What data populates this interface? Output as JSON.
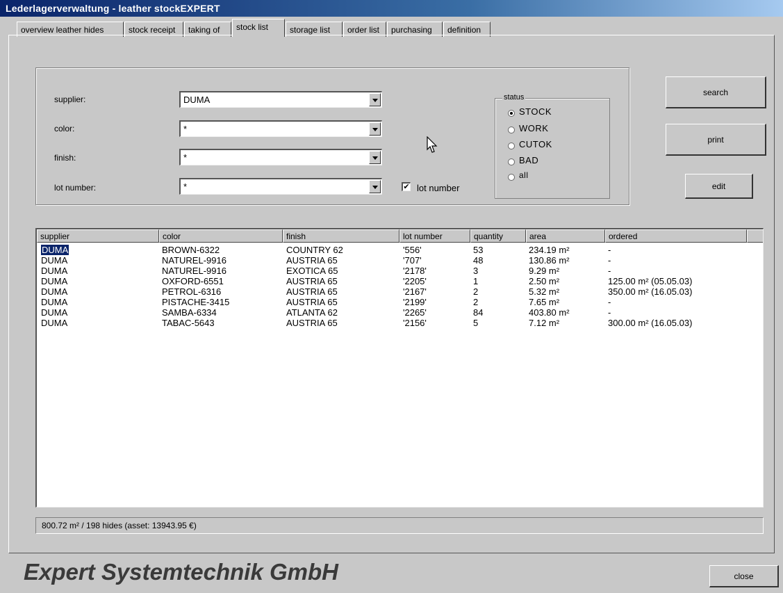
{
  "window": {
    "title": "Lederlagerverwaltung - leather stockEXPERT"
  },
  "tabs": [
    {
      "label": "overview leather hides"
    },
    {
      "label": "stock receipt"
    },
    {
      "label": "taking of"
    },
    {
      "label": "stock list"
    },
    {
      "label": "storage list"
    },
    {
      "label": "order list"
    },
    {
      "label": "purchasing"
    },
    {
      "label": "definition"
    }
  ],
  "filters": {
    "supplier_label": "supplier:",
    "supplier_value": "DUMA",
    "color_label": "color:",
    "color_value": "*",
    "finish_label": "finish:",
    "finish_value": "*",
    "lot_label": "lot number:",
    "lot_value": "*",
    "lot_checkbox_label": "lot number",
    "lot_checkbox_checked": "✔"
  },
  "status": {
    "legend": "status",
    "options": [
      "STOCK",
      "WORK",
      "CUTOK",
      "BAD",
      "all"
    ],
    "selected": "STOCK"
  },
  "buttons": {
    "search": "search",
    "print": "print",
    "edit": "edit",
    "close": "close"
  },
  "table": {
    "columns": [
      "supplier",
      "color",
      "finish",
      "lot number",
      "quantity",
      "area",
      "ordered"
    ],
    "rows": [
      {
        "supplier": "DUMA",
        "color": "BROWN-6322",
        "finish": "COUNTRY 62",
        "lot": "'556'",
        "quantity": "53",
        "area": "234.19 m²",
        "ordered": "-"
      },
      {
        "supplier": "DUMA",
        "color": "NATUREL-9916",
        "finish": "AUSTRIA 65",
        "lot": "'707'",
        "quantity": "48",
        "area": "130.86 m²",
        "ordered": "-"
      },
      {
        "supplier": "DUMA",
        "color": "NATUREL-9916",
        "finish": "EXOTICA 65",
        "lot": "'2178'",
        "quantity": "3",
        "area": "9.29 m²",
        "ordered": "-"
      },
      {
        "supplier": "DUMA",
        "color": "OXFORD-6551",
        "finish": "AUSTRIA 65",
        "lot": "'2205'",
        "quantity": "1",
        "area": "2.50 m²",
        "ordered": "125.00 m² (05.05.03)"
      },
      {
        "supplier": "DUMA",
        "color": "PETROL-6316",
        "finish": "AUSTRIA 65",
        "lot": "'2167'",
        "quantity": "2",
        "area": "5.32 m²",
        "ordered": "350.00 m² (16.05.03)"
      },
      {
        "supplier": "DUMA",
        "color": "PISTACHE-3415",
        "finish": "AUSTRIA 65",
        "lot": "'2199'",
        "quantity": "2",
        "area": "7.65 m²",
        "ordered": "-"
      },
      {
        "supplier": "DUMA",
        "color": "SAMBA-6334",
        "finish": "ATLANTA 62",
        "lot": "'2265'",
        "quantity": "84",
        "area": "403.80 m²",
        "ordered": "-"
      },
      {
        "supplier": "DUMA",
        "color": "TABAC-5643",
        "finish": "AUSTRIA 65",
        "lot": "'2156'",
        "quantity": "5",
        "area": "7.12 m²",
        "ordered": "300.00 m² (16.05.03)"
      }
    ]
  },
  "summary": "800.72 m² / 198 hides  (asset:  13943.95 €)",
  "brand": "Expert Systemtechnik GmbH"
}
